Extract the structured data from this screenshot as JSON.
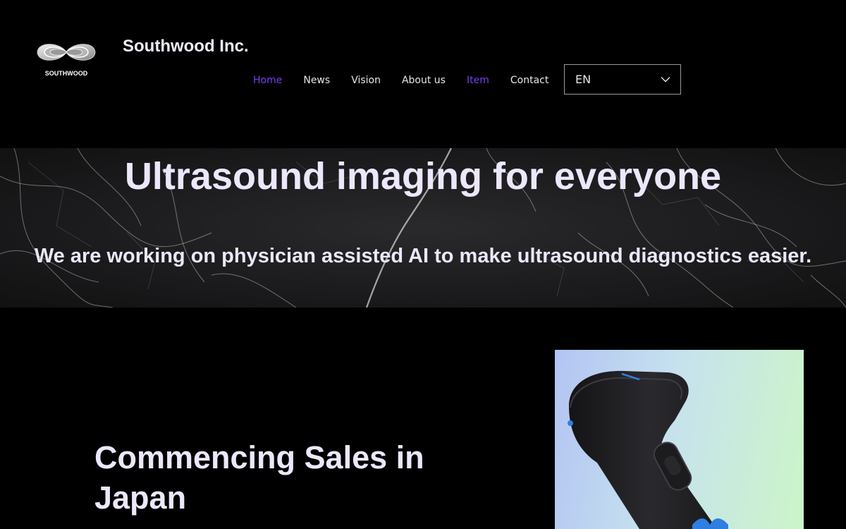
{
  "brand": {
    "logo_text": "SOUTHWOOD",
    "site_title": "Southwood Inc."
  },
  "nav": {
    "items": [
      {
        "label": "Home",
        "active": true
      },
      {
        "label": "News",
        "active": false
      },
      {
        "label": "Vision",
        "active": false
      },
      {
        "label": "About us",
        "active": false
      },
      {
        "label": "Item",
        "active": true
      },
      {
        "label": "Contact",
        "active": false
      }
    ],
    "language": "EN"
  },
  "hero": {
    "title": "Ultrasound imaging for everyone",
    "subtitle": "We are working on physician assisted AI to make ultrasound diagnostics easier."
  },
  "section": {
    "title": "Commencing Sales in Japan"
  },
  "colors": {
    "background": "#000000",
    "accent": "#7a3cf0",
    "text_light": "#ece7fb"
  },
  "icons": {
    "language_dropdown": "chevron-down-icon",
    "logo": "infinity-logo-icon"
  }
}
